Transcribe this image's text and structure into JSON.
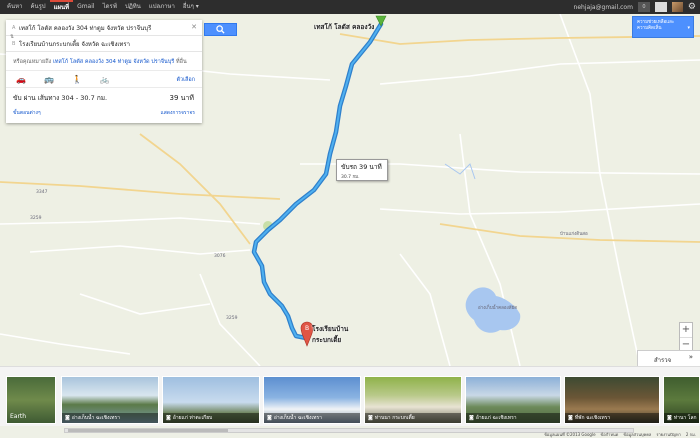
{
  "topbar": {
    "nav": [
      "ค้นหา",
      "ค้นรูป",
      "แผนที่",
      "Gmail",
      "ไดรฟ์",
      "ปฏิทิน",
      "แปลภาษา",
      "อื่นๆ ▾"
    ],
    "active_index": 2,
    "email": "nehjaja@gmail.com",
    "notifications": "0"
  },
  "directions": {
    "from_label": "A",
    "from": "เทสโก้ โลตัส คลองวัง 304 ท่าตูม จังหวัด ปราจีนบุรี",
    "to_label": "B",
    "to": "โรงเรียนบ้านกระบกเตี้ย จังหวัด ฉะเชิงเทรา",
    "suggest_prefix": "หรือคุณหมายถึง",
    "suggest_link": "เทสโก้ โลตัส คลองวัง 304 ท่าตูม จังหวัด ปราจีนบุรี",
    "suggest_suffix": "ที่อื่น",
    "options_label": "ตัวเลือก",
    "route_via": "ขับ ผ่าน เส้นทาง 304 - 30.7 กม.",
    "route_time": "39 นาที",
    "route_link_left": "ขั้นตอนต่างๆ",
    "route_link_right": "แสดงการจราจร"
  },
  "map": {
    "start_label": "เทสโก้ โลตัส คลองวัง",
    "end_label_1": "โรงเรียนบ้าน",
    "end_label_2": "กระบกเตี้ย",
    "end_marker": "B",
    "callout_time": "ขับรถ 39 นาที",
    "callout_dist": "30.7 กม.",
    "places": {
      "p1": "3347",
      "p2": "3259",
      "p3": "3076",
      "p4": "บ้านแก่งดินสอ",
      "p5": "อ่างเก็บน้ำคลองสียัด",
      "p6": "3259"
    },
    "route_color": "#2a8fd6",
    "water_color": "#a8c7f0"
  },
  "layers_button": {
    "line1": "ความช่วยเหลือและ",
    "line2": "ความคิดเห็น"
  },
  "zoom": {
    "in": "+",
    "out": "−"
  },
  "explore_label": "สำรวจ",
  "photos": [
    {
      "caption": "Earth",
      "camera": false
    },
    {
      "caption": "อ่างเก็บน้ำ ฉะเชิงเทรา",
      "camera": true
    },
    {
      "caption": "อ้ายแก่ ท่าตะเกียบ",
      "camera": true
    },
    {
      "caption": "อ่างเก็บน้ำ ฉะเชิงเทรา",
      "camera": true
    },
    {
      "caption": "ท่านนา กระบกเตี้ย",
      "camera": true
    },
    {
      "caption": "อ้ายแก่ ฉะเชิงเทรา",
      "camera": true
    },
    {
      "caption": "ที่พัก ฉะเชิงเทรา",
      "camera": true
    },
    {
      "caption": "ท่านา โลก",
      "camera": true
    }
  ],
  "footer": [
    "ข้อมูลแผนที่ ©2013 Google",
    "ข้อกำหนด",
    "ข้อมูลส่วนบุคคล",
    "รายงานปัญหา",
    "2 กม."
  ]
}
